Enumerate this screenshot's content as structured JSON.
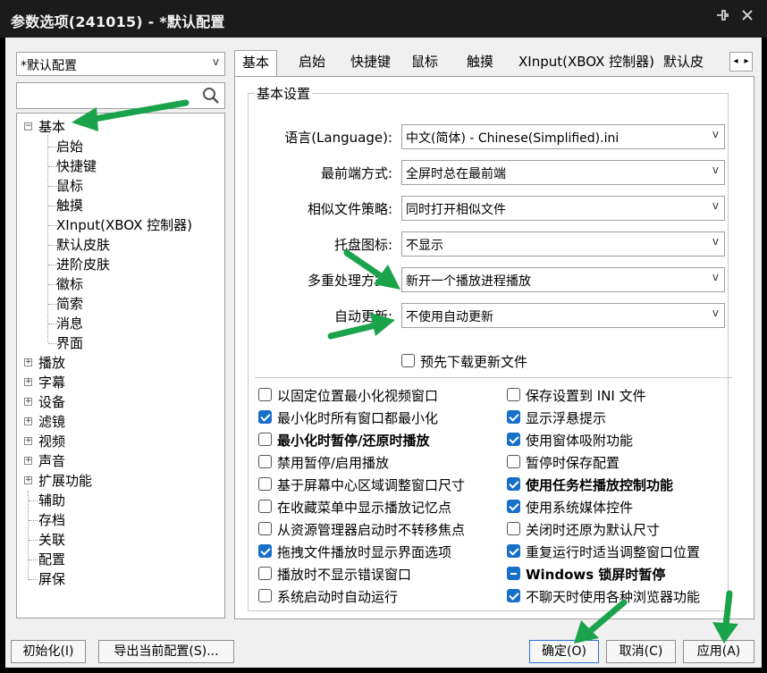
{
  "window": {
    "title": "参数选项(241015) - *默认配置",
    "pin_icon": "pin-icon",
    "close_icon": "close-icon"
  },
  "profile_select": {
    "value": "*默认配置"
  },
  "search": {
    "value": "",
    "icon": "search-icon"
  },
  "tree": {
    "expanded": {
      "label": "基本",
      "children": [
        "启始",
        "快捷键",
        "鼠标",
        "触摸",
        "XInput(XBOX 控制器)",
        "默认皮肤",
        "进阶皮肤",
        "徽标",
        "简索",
        "消息",
        "界面"
      ]
    },
    "collapsed": [
      "播放",
      "字幕",
      "设备",
      "滤镜",
      "视频",
      "声音",
      "扩展功能"
    ],
    "leaves": [
      "辅助",
      "存档",
      "关联",
      "配置",
      "屏保"
    ]
  },
  "tabs": [
    "基本",
    "启始",
    "快捷键",
    "鼠标",
    "触摸",
    "XInput(XBOX 控制器)",
    "默认皮"
  ],
  "group_title": "基本设置",
  "settings": [
    {
      "label": "语言(Language):",
      "value": "中文(简体) - Chinese(Simplified).ini"
    },
    {
      "label": "最前端方式:",
      "value": "全屏时总在最前端"
    },
    {
      "label": "相似文件策略:",
      "value": "同时打开相似文件"
    },
    {
      "label": "托盘图标:",
      "value": "不显示"
    },
    {
      "label": "多重处理方式:",
      "value": "新开一个播放进程播放"
    },
    {
      "label": "自动更新:",
      "value": "不使用自动更新"
    }
  ],
  "predownload": {
    "label": "预先下载更新文件",
    "checked": false
  },
  "options_left": [
    {
      "label": "以固定位置最小化视频窗口",
      "checked": false,
      "bold": false
    },
    {
      "label": "最小化时所有窗口都最小化",
      "checked": true,
      "bold": false
    },
    {
      "label": "最小化时暂停/还原时播放",
      "checked": false,
      "bold": true
    },
    {
      "label": "禁用暂停/启用播放",
      "checked": false,
      "bold": false
    },
    {
      "label": "基于屏幕中心区域调整窗口尺寸",
      "checked": false,
      "bold": false
    },
    {
      "label": "在收藏菜单中显示播放记忆点",
      "checked": false,
      "bold": false
    },
    {
      "label": "从资源管理器启动时不转移焦点",
      "checked": false,
      "bold": false
    },
    {
      "label": "拖拽文件播放时显示界面选项",
      "checked": true,
      "bold": false
    },
    {
      "label": "播放时不显示错误窗口",
      "checked": false,
      "bold": false
    },
    {
      "label": "系统启动时自动运行",
      "checked": false,
      "bold": false
    }
  ],
  "options_right": [
    {
      "label": "保存设置到 INI 文件",
      "checked": false,
      "bold": false,
      "state": "off"
    },
    {
      "label": "显示浮悬提示",
      "checked": true,
      "bold": false,
      "state": "on"
    },
    {
      "label": "使用窗体吸附功能",
      "checked": true,
      "bold": false,
      "state": "on"
    },
    {
      "label": "暂停时保存配置",
      "checked": false,
      "bold": false,
      "state": "off"
    },
    {
      "label": "使用任务栏播放控制功能",
      "checked": true,
      "bold": true,
      "state": "on"
    },
    {
      "label": "使用系统媒体控件",
      "checked": true,
      "bold": false,
      "state": "on"
    },
    {
      "label": "关闭时还原为默认尺寸",
      "checked": false,
      "bold": false,
      "state": "off"
    },
    {
      "label": "重复运行时适当调整窗口位置",
      "checked": true,
      "bold": false,
      "state": "on"
    },
    {
      "label": "Windows 锁屏时暂停",
      "checked": null,
      "bold": true,
      "state": "indeterminate"
    },
    {
      "label": "不聊天时使用各种浏览器功能",
      "checked": true,
      "bold": false,
      "state": "on"
    }
  ],
  "buttons": {
    "init": "初始化(I)",
    "export": "导出当前配置(S)...",
    "ok": "确定(O)",
    "cancel": "取消(C)",
    "apply": "应用(A)"
  },
  "colors": {
    "accent": "#1670c8",
    "arrow": "#1aa34a",
    "titlebar": "#1b1b1b"
  }
}
